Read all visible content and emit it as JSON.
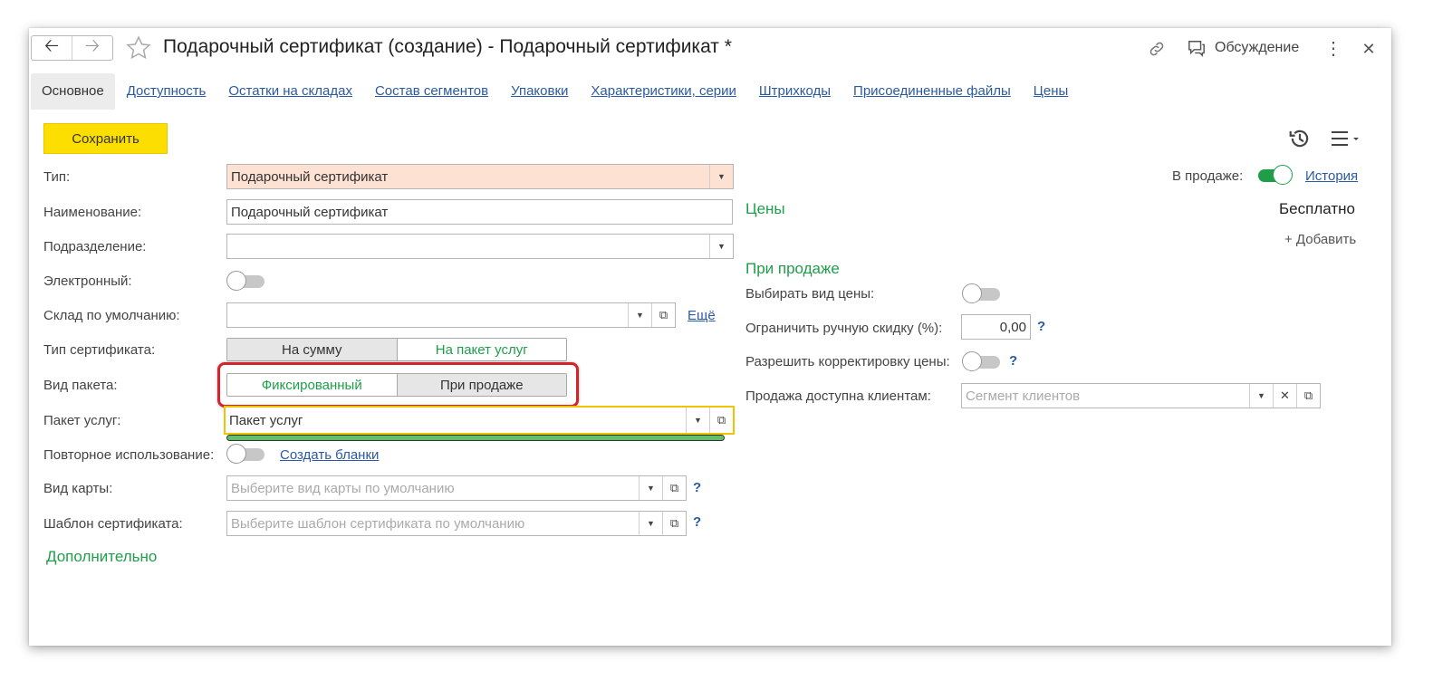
{
  "window": {
    "title": "Подарочный сертификат (создание) - Подарочный сертификат *",
    "discussion_label": "Обсуждение"
  },
  "tabs": [
    {
      "label": "Основное",
      "active": true
    },
    {
      "label": "Доступность"
    },
    {
      "label": "Остатки на складах"
    },
    {
      "label": "Состав сегментов"
    },
    {
      "label": "Упаковки"
    },
    {
      "label": "Характеристики, серии"
    },
    {
      "label": "Штрихкоды"
    },
    {
      "label": "Присоединенные файлы"
    },
    {
      "label": "Цены"
    }
  ],
  "toolbar": {
    "save_label": "Сохранить"
  },
  "form": {
    "type_label": "Тип:",
    "type_value": "Подарочный сертификат",
    "name_label": "Наименование:",
    "name_value": "Подарочный сертификат",
    "division_label": "Подразделение:",
    "division_value": "",
    "electronic_label": "Электронный:",
    "warehouse_label": "Склад по умолчанию:",
    "warehouse_value": "",
    "more_link": "Ещё",
    "cert_type_label": "Тип сертификата:",
    "cert_type_options": [
      "На сумму",
      "На пакет услуг"
    ],
    "package_kind_label": "Вид пакета:",
    "package_kind_options": [
      "Фиксированный",
      "При продаже"
    ],
    "package_label": "Пакет услуг:",
    "package_value": "Пакет услуг",
    "reuse_label": "Повторное использование:",
    "create_blanks_link": "Создать бланки",
    "card_kind_label": "Вид карты:",
    "card_kind_placeholder": "Выберите вид карты по умолчанию",
    "template_label": "Шаблон сертификата:",
    "template_placeholder": "Выберите шаблон сертификата по умолчанию",
    "additional_heading": "Дополнительно"
  },
  "right": {
    "on_sale_label": "В продаже:",
    "history_link": "История",
    "prices_heading": "Цены",
    "free_label": "Бесплатно",
    "add_label": "+ Добавить",
    "on_sale_heading": "При продаже",
    "choose_price_label": "Выбирать вид цены:",
    "limit_discount_label": "Ограничить ручную скидку (%):",
    "limit_discount_value": "0,00",
    "allow_correction_label": "Разрешить корректировку цены:",
    "clients_label": "Продажа доступна клиентам:",
    "clients_placeholder": "Сегмент клиентов",
    "question": "?"
  },
  "colors": {
    "accent_green": "#1f9e4a",
    "save_yellow": "#fcdf00",
    "link_blue": "#2a5aa3",
    "highlight_red": "#d2232a",
    "required_field_bg": "#fde1d2"
  },
  "icons": [
    "back-arrow-icon",
    "forward-arrow-icon",
    "star-icon",
    "link-icon",
    "discussion-icon",
    "more-icon",
    "close-icon",
    "history-icon",
    "menu-icon",
    "dropdown-icon",
    "open-icon",
    "clear-icon"
  ]
}
